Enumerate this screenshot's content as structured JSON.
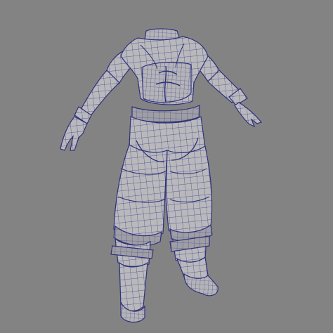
{
  "scene": {
    "subject": "mesh-model",
    "background_color": "#838383",
    "surface_color": "#b7b7b9",
    "shadow_color": "#8f8f93",
    "wire_color": "#3b3d8f"
  }
}
